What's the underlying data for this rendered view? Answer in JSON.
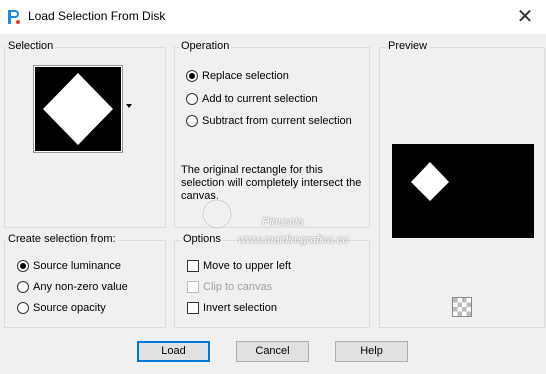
{
  "window": {
    "title": "Load Selection From Disk",
    "close_glyph": "✕"
  },
  "selection": {
    "label": "Selection"
  },
  "operation": {
    "label": "Operation",
    "options": [
      {
        "label": "Replace selection",
        "checked": true
      },
      {
        "label": "Add to current selection",
        "checked": false
      },
      {
        "label": "Subtract from current selection",
        "checked": false
      }
    ],
    "description": "The original rectangle for this selection will completely intersect the canvas."
  },
  "preview": {
    "label": "Preview"
  },
  "create_from": {
    "label": "Create selection from:",
    "options": [
      {
        "label": "Source luminance",
        "checked": true
      },
      {
        "label": "Any non-zero value",
        "checked": false
      },
      {
        "label": "Source opacity",
        "checked": false
      }
    ]
  },
  "options": {
    "label": "Options",
    "items": [
      {
        "label": "Move to upper left",
        "checked": false,
        "enabled": true
      },
      {
        "label": "Clip to canvas",
        "checked": false,
        "enabled": false
      },
      {
        "label": "Invert selection",
        "checked": false,
        "enabled": true
      }
    ]
  },
  "buttons": {
    "load": "Load",
    "cancel": "Cancel",
    "help": "Help"
  },
  "watermark": {
    "line1": "Pinuccia",
    "line2": "www.maidiregrafica.eu"
  }
}
